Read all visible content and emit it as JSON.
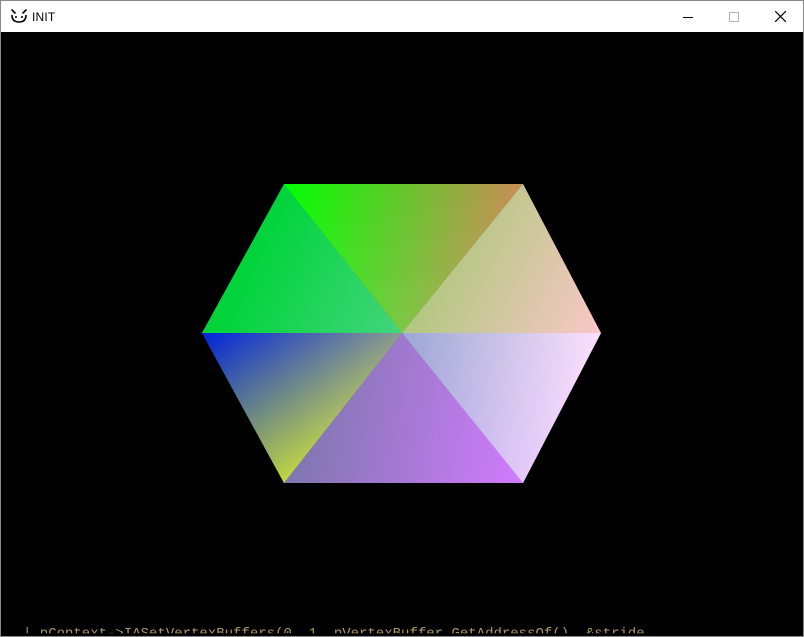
{
  "window": {
    "title": "INIT",
    "controls": {
      "minimize_icon": "minimize-icon",
      "maximize_icon": "maximize-icon",
      "close_icon": "close-icon"
    }
  },
  "render": {
    "shape": "hexagon",
    "background": "#000000",
    "vertex_colors": {
      "top_left": "#00ff00",
      "top_right": "#ff0000",
      "right": "#ffffff",
      "bottom_right": "#ff00ff",
      "bottom_left": "#ffff00",
      "left": "#0000ff"
    }
  },
  "background_text": "|   pContext->IASetVertexBuffers(0, 1, pVertexBuffer.GetAddressOf(), &stride"
}
